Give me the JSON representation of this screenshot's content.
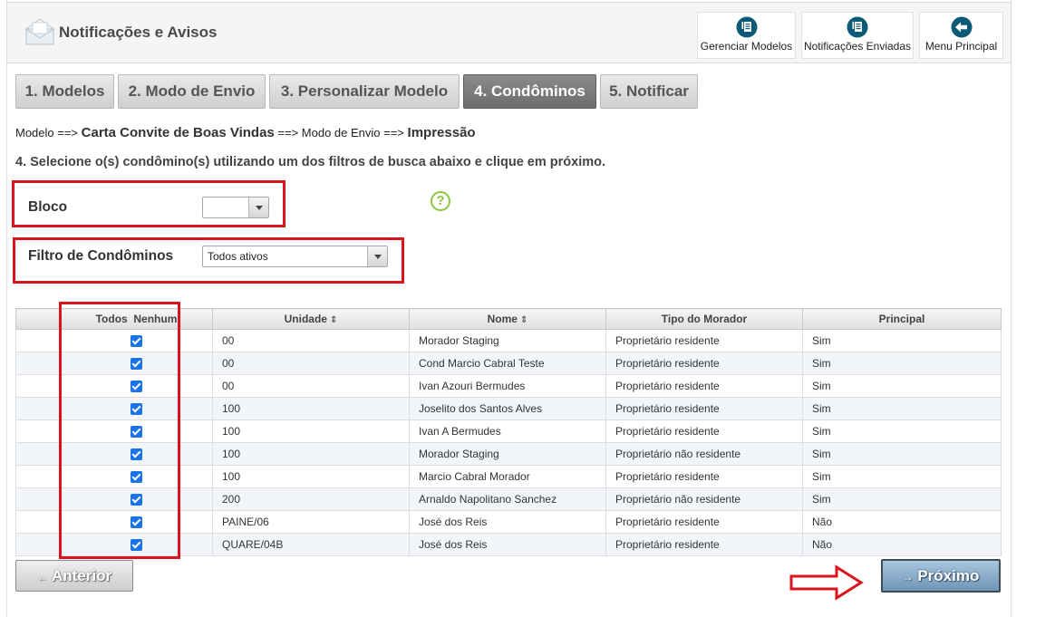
{
  "header": {
    "title": "Notificações e Avisos",
    "buttons": [
      {
        "label": "Gerenciar Modelos",
        "icon": "document-list-icon"
      },
      {
        "label": "Notificações Enviadas",
        "icon": "sent-document-icon"
      },
      {
        "label": "Menu Principal",
        "icon": "back-arrow-icon"
      }
    ]
  },
  "tabs": [
    {
      "label": "1. Modelos",
      "active": false
    },
    {
      "label": "2. Modo de Envio",
      "active": false
    },
    {
      "label": "3. Personalizar Modelo",
      "active": false
    },
    {
      "label": "4. Condôminos",
      "active": true
    },
    {
      "label": "5. Notificar",
      "active": false
    }
  ],
  "breadcrumb": {
    "model_prefix": "Modelo ==>",
    "model_name": "Carta Convite de Boas Vindas",
    "mode_prefix": "==> Modo de Envio ==>",
    "mode_name": "Impressão"
  },
  "instruction": "4. Selecione o(s) condômino(s) utilizando um dos filtros de busca abaixo e clique em próximo.",
  "filters": {
    "bloco_label": "Bloco",
    "bloco_value": "",
    "filtro_label": "Filtro de Condôminos",
    "filtro_value": "Todos ativos"
  },
  "table": {
    "select_all": "Todos",
    "select_none": "Nenhum",
    "columns": [
      "Unidade",
      "Nome",
      "Tipo do Morador",
      "Principal"
    ],
    "rows": [
      {
        "checked": true,
        "unidade": "00",
        "nome": "Morador Staging",
        "tipo": "Proprietário residente",
        "principal": "Sim"
      },
      {
        "checked": true,
        "unidade": "00",
        "nome": "Cond Marcio Cabral Teste",
        "tipo": "Proprietário residente",
        "principal": "Sim"
      },
      {
        "checked": true,
        "unidade": "00",
        "nome": "Ivan Azouri Bermudes",
        "tipo": "Proprietário residente",
        "principal": "Sim"
      },
      {
        "checked": true,
        "unidade": "100",
        "nome": "Joselito dos Santos Alves",
        "tipo": "Proprietário residente",
        "principal": "Sim"
      },
      {
        "checked": true,
        "unidade": "100",
        "nome": "Ivan A Bermudes",
        "tipo": "Proprietário residente",
        "principal": "Sim"
      },
      {
        "checked": true,
        "unidade": "100",
        "nome": "Morador Staging",
        "tipo": "Proprietário não residente",
        "principal": "Sim"
      },
      {
        "checked": true,
        "unidade": "100",
        "nome": "Marcio Cabral Morador",
        "tipo": "Proprietário residente",
        "principal": "Sim"
      },
      {
        "checked": true,
        "unidade": "200",
        "nome": "Arnaldo Napolitano Sanchez",
        "tipo": "Proprietário não residente",
        "principal": "Sim"
      },
      {
        "checked": true,
        "unidade": "PAINE/06",
        "nome": "José dos Reis",
        "tipo": "Proprietário residente",
        "principal": "Não"
      },
      {
        "checked": true,
        "unidade": "QUARE/04B",
        "nome": "José dos Reis",
        "tipo": "Proprietário residente",
        "principal": "Não"
      }
    ]
  },
  "actions": {
    "prev_label": "Anterior",
    "next_label": "Próximo"
  },
  "colors": {
    "highlight_red": "#d9141c",
    "checkbox_blue": "#1a73e8",
    "icon_teal": "#0d5a78"
  }
}
